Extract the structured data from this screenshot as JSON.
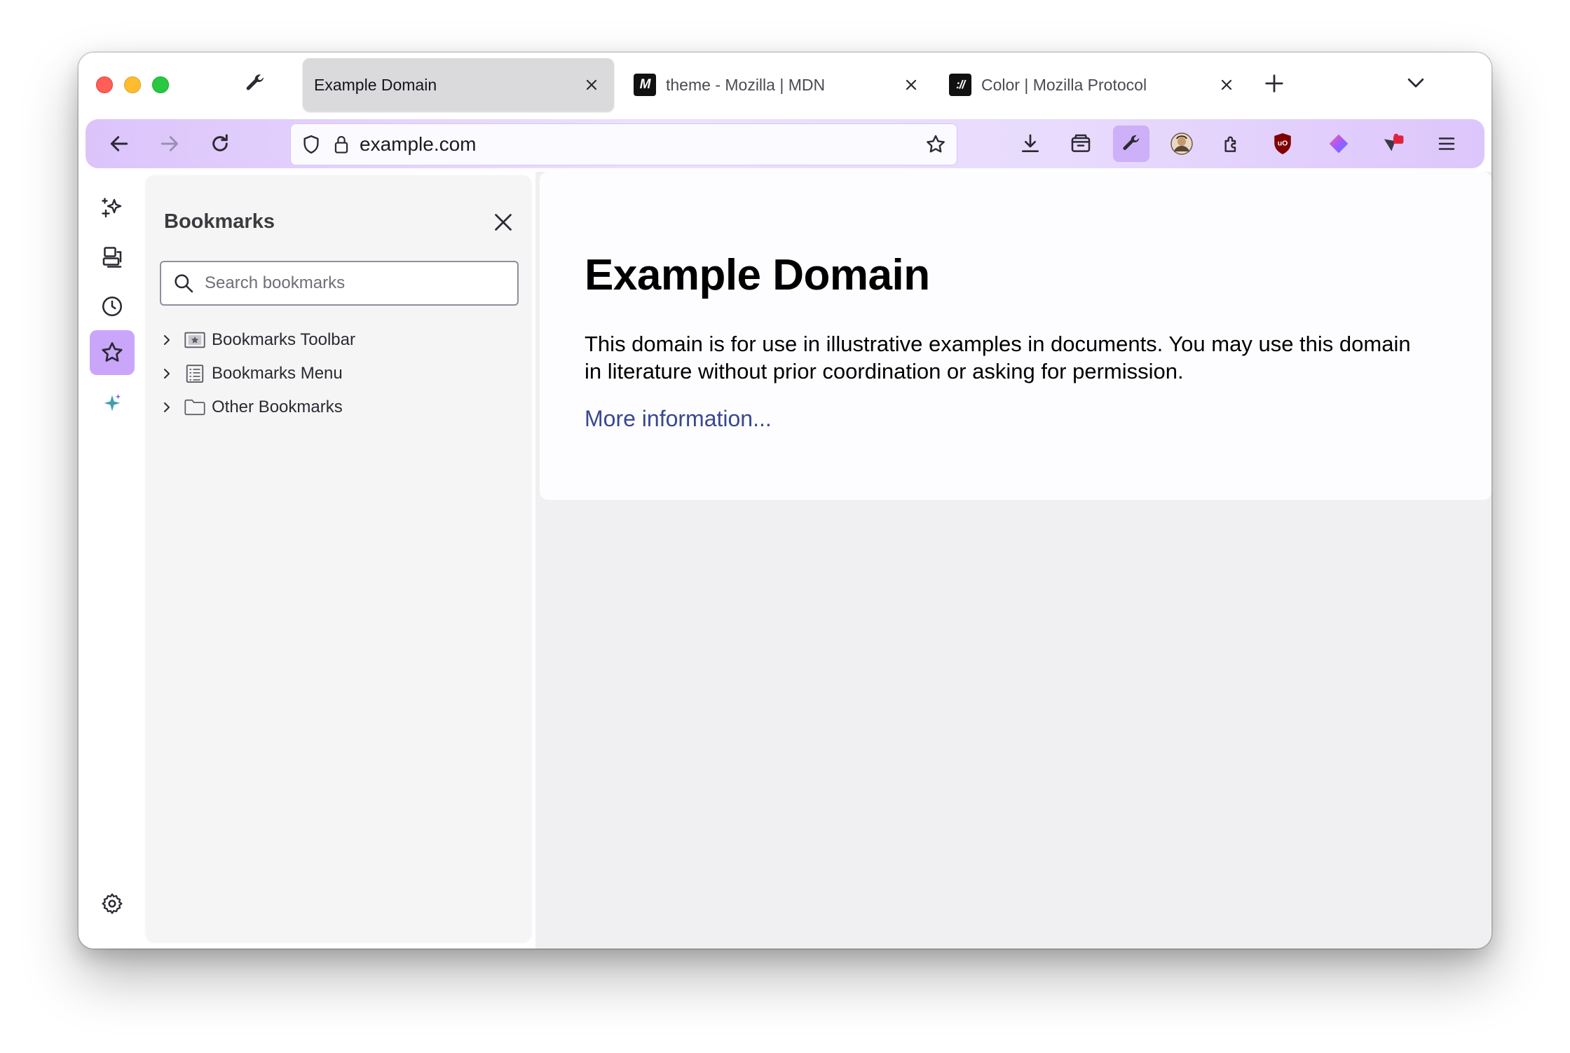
{
  "tabs": [
    {
      "title": "Example Domain",
      "active": true,
      "favicon": ""
    },
    {
      "title": "theme - Mozilla | MDN",
      "active": false,
      "favicon": "M"
    },
    {
      "title": "Color | Mozilla Protocol",
      "active": false,
      "favicon": "://"
    }
  ],
  "tabstrip": {
    "pinned_icon": "wrench-icon",
    "new_tab_icon": "plus-icon",
    "list_all_icon": "chevron-down-icon"
  },
  "navbar": {
    "url": "example.com",
    "accent_color": "#dcc4fb"
  },
  "sidebar": {
    "tools": [
      "ai-chatbot",
      "synced-tabs",
      "history",
      "bookmarks",
      "suggestions"
    ],
    "active_tool": "bookmarks",
    "panel": {
      "title": "Bookmarks",
      "search_placeholder": "Search bookmarks",
      "items": [
        {
          "label": "Bookmarks Toolbar"
        },
        {
          "label": "Bookmarks Menu"
        },
        {
          "label": "Other Bookmarks"
        }
      ]
    }
  },
  "page": {
    "heading": "Example Domain",
    "body": "This domain is for use in illustrative examples in documents. You may use this domain in literature without prior coordination or asking for permission.",
    "link": "More information..."
  }
}
